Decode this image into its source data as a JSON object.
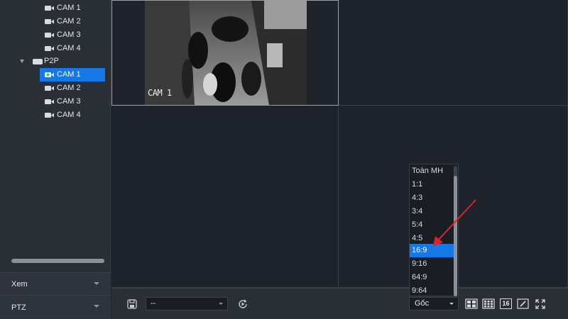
{
  "tree": {
    "group1_cams": [
      "CAM 1",
      "CAM 2",
      "CAM 3",
      "CAM 4"
    ],
    "group2_label": "P2P",
    "group2_cams": [
      "CAM 1",
      "CAM 2",
      "CAM 3",
      "CAM 4"
    ],
    "selected": "P2P / CAM 1"
  },
  "panels": {
    "view_label": "Xem",
    "ptz_label": "PTZ"
  },
  "video": {
    "cell1_overlay": "CAM 1"
  },
  "toolbar": {
    "stream_value": "--",
    "ratio_value": "Gốc",
    "layout_16_label": "16"
  },
  "ratio_dropdown": {
    "options": [
      "Toàn MH",
      "1:1",
      "4:3",
      "3:4",
      "5:4",
      "4:5",
      "16:9",
      "9:16",
      "64:9",
      "9:64"
    ],
    "selected": "16:9"
  },
  "colors": {
    "selection": "#1677e8",
    "background": "#1f232b",
    "sidebar": "#2a2e35",
    "pointer_arrow": "#e0202a"
  },
  "icons": {
    "camera": "camera-icon",
    "device": "device-icon",
    "save": "save-icon",
    "refresh": "refresh-icon",
    "layout_4": "grid-4-icon",
    "layout_9": "grid-9-icon",
    "edit": "pencil-icon",
    "fullscreen": "fullscreen-icon"
  }
}
